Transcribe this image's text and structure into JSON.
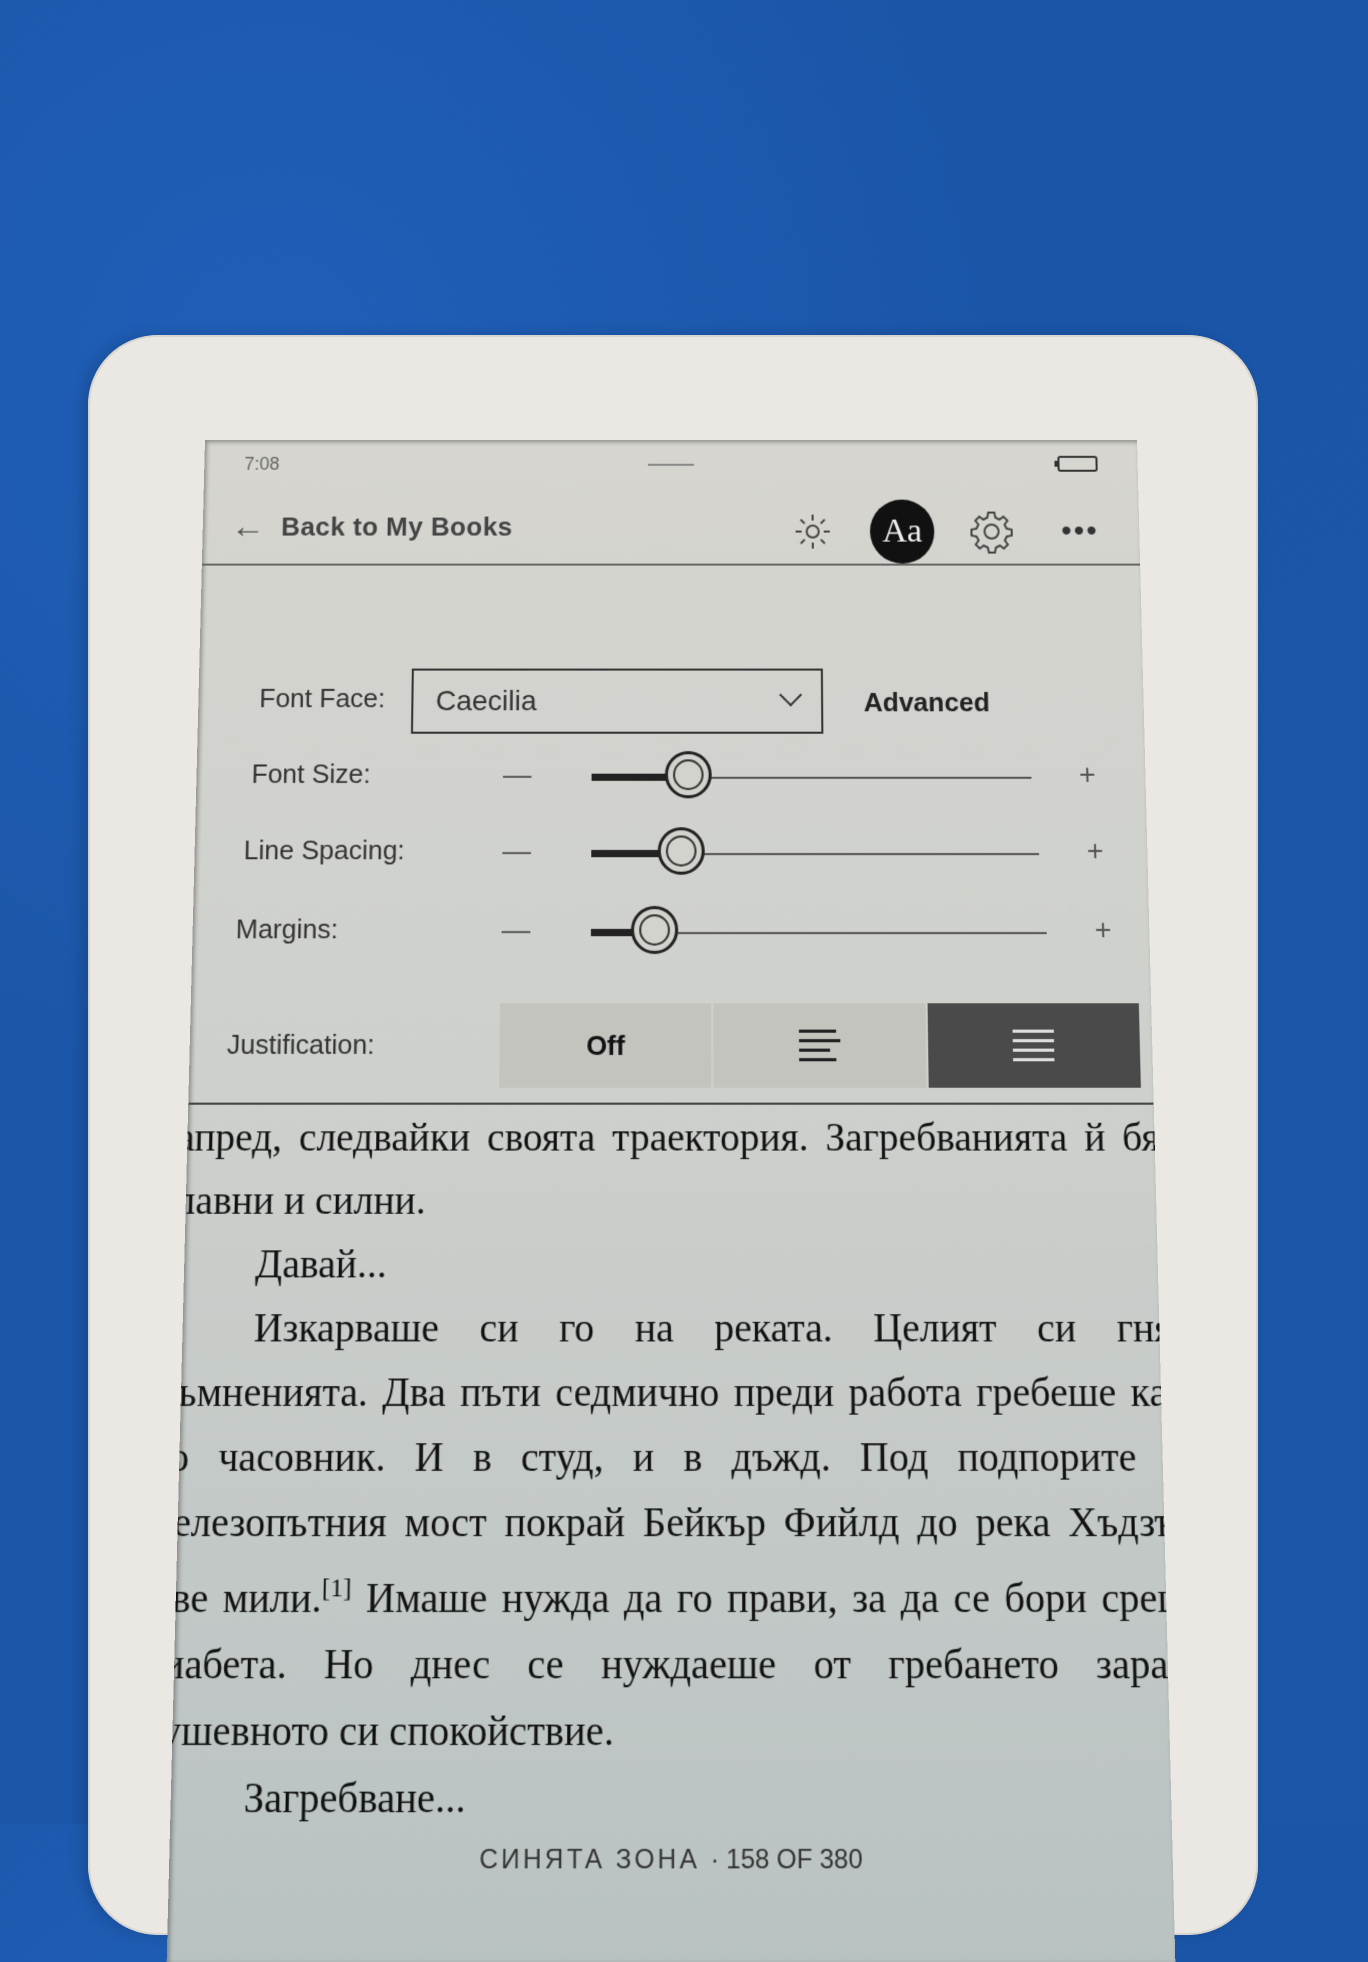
{
  "status_bar": {
    "time": "7:08",
    "battery_icon": "battery-full-icon"
  },
  "top_bar": {
    "back_label": "Back to My Books",
    "back_icon": "arrow-left-icon",
    "icons": [
      "brightness-icon",
      "font-settings-icon",
      "gear-icon",
      "more-icon"
    ],
    "font_settings_label": "Aa",
    "more_label": "•••"
  },
  "settings": {
    "font_face": {
      "label": "Font Face:",
      "value": "Caecilia",
      "advanced_label": "Advanced"
    },
    "font_size": {
      "label": "Font Size:",
      "value_fraction": 0.22,
      "minus": "—",
      "plus": "+"
    },
    "line_spacing": {
      "label": "Line Spacing:",
      "value_fraction": 0.2,
      "minus": "—",
      "plus": "+"
    },
    "margins": {
      "label": "Margins:",
      "value_fraction": 0.14,
      "minus": "—",
      "plus": "+"
    },
    "justification": {
      "label": "Justification:",
      "options": [
        "Off",
        "left-align-icon",
        "justify-icon"
      ],
      "off_label": "Off",
      "selected_index": 2
    }
  },
  "book": {
    "paragraphs": [
      "напред, следвайки своята траектория. Загребванията й бяха плавни и силни.",
      "Давай...",
      "Изкарваше си го на реката. Целият си гняв. Съмненията. Два пъти седмично преди работа гребеше като по часовник. И в студ, и в дъжд. Под подпорите на железопътния мост покрай Бейкър Фийлд до река Хъдзън. Две мили.",
      "Имаше нужда да го прави, за да се бори срещу диабета. Но днес се нуждаеше от гребането заради душевното си спокойствие.",
      "Загребване..."
    ],
    "footnote_marker": "[1]",
    "footer_title": "СИНЯТА ЗОНА",
    "footer_page": "· 158 OF 380"
  }
}
